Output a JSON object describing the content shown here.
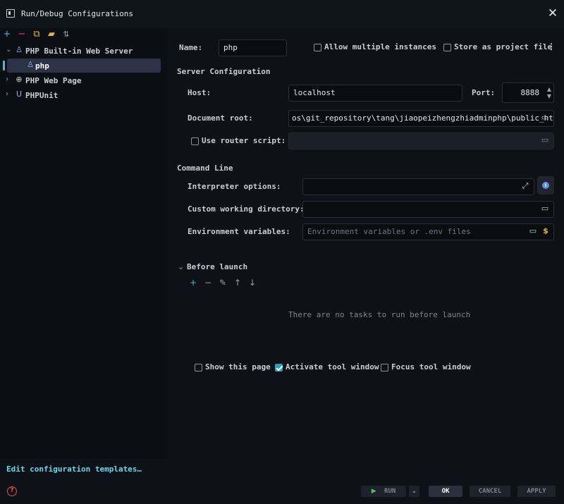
{
  "window": {
    "title": "Run/Debug Configurations"
  },
  "sidebar": {
    "toolbar": [
      "add-icon",
      "remove-icon",
      "copy-icon",
      "folder-icon",
      "sort-icon"
    ],
    "tree": [
      {
        "label": "PHP Built-in Web Server",
        "expanded": true,
        "icon": "php-server-icon"
      },
      {
        "label": "php",
        "selected": true,
        "icon": "php-config-icon"
      },
      {
        "label": "PHP Web Page",
        "expanded": false,
        "icon": "globe-icon"
      },
      {
        "label": "PHPUnit",
        "expanded": false,
        "icon": "phpunit-icon"
      }
    ],
    "edit_templates": "Edit configuration templates…"
  },
  "form": {
    "name_label": "Name:",
    "name_value": "php",
    "allow_multiple": {
      "label": "Allow multiple instances",
      "checked": false
    },
    "store_project": {
      "label": "Store as project file",
      "checked": false
    },
    "server_section": "Server Configuration",
    "host_label": "Host:",
    "host_value": "localhost",
    "port_label": "Port:",
    "port_value": "8888",
    "docroot_label": "Document root:",
    "docroot_value": "os\\git_repository\\tang\\jiaopeizhengzhiadminphp\\public_html",
    "router": {
      "label": "Use router script:",
      "checked": false
    },
    "command_section": "Command Line",
    "interp_label": "Interpreter options:",
    "cwd_label": "Custom working directory:",
    "env_label": "Environment variables:",
    "env_placeholder": "Environment variables or .env files",
    "before_launch": "Before launch",
    "no_tasks": "There are no tasks to run before launch",
    "show_page": {
      "label": "Show this page",
      "checked": false
    },
    "activate_tool": {
      "label": "Activate tool window",
      "checked": true
    },
    "focus_tool": {
      "label": "Focus tool window",
      "checked": false
    }
  },
  "buttons": {
    "run": "RUN",
    "ok": "OK",
    "cancel": "CANCEL",
    "apply": "APPLY"
  },
  "colors": {
    "accent": "#6dd8e8",
    "selection": "#2c3344",
    "checkbox_on": "#2f9fb5",
    "error": "#e04e4e"
  }
}
